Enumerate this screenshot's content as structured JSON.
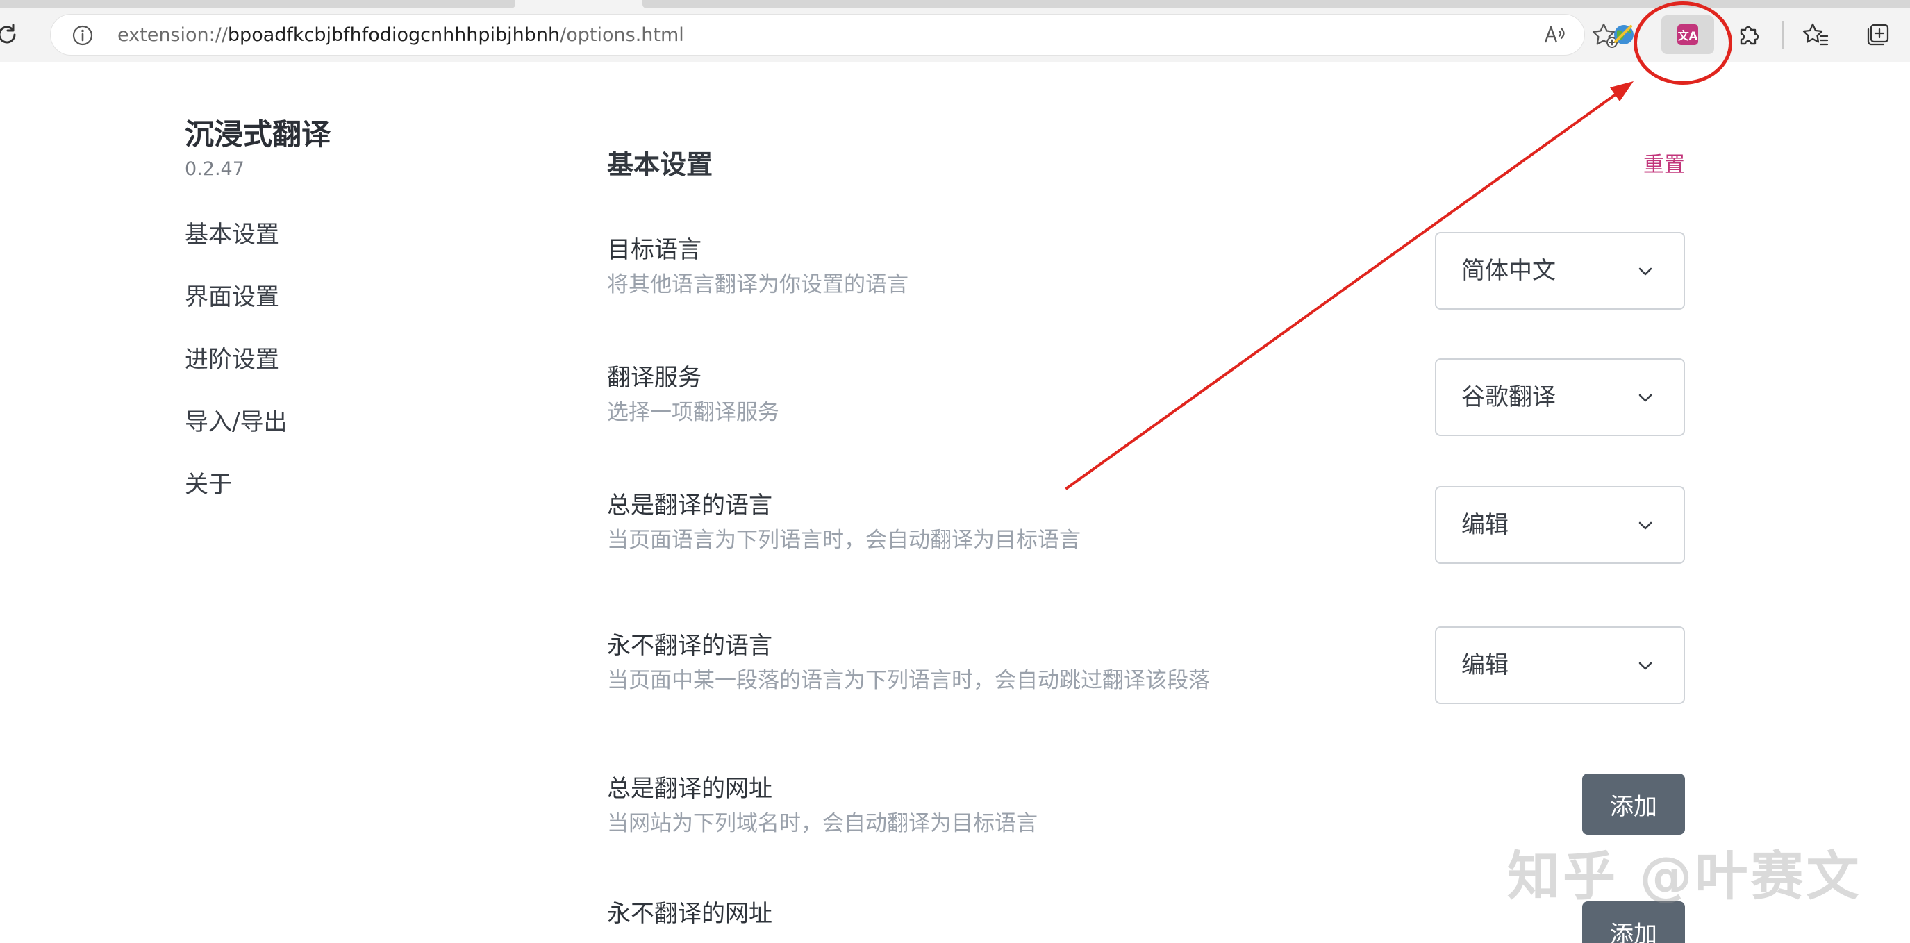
{
  "browser": {
    "url_scheme": "extension://",
    "url_host": "bpoadfkcbjbfhfodiogcnhhhpibjhbnh",
    "url_path": "/options.html"
  },
  "sidebar": {
    "title": "沉浸式翻译",
    "version": "0.2.47",
    "items": [
      {
        "label": "基本设置"
      },
      {
        "label": "界面设置"
      },
      {
        "label": "进阶设置"
      },
      {
        "label": "导入/导出"
      },
      {
        "label": "关于"
      }
    ]
  },
  "main": {
    "section_title": "基本设置",
    "reset_label": "重置",
    "settings": [
      {
        "label": "目标语言",
        "desc": "将其他语言翻译为你设置的语言",
        "control": "select",
        "value": "简体中文"
      },
      {
        "label": "翻译服务",
        "desc": "选择一项翻译服务",
        "control": "select",
        "value": "谷歌翻译"
      },
      {
        "label": "总是翻译的语言",
        "desc": "当页面语言为下列语言时，会自动翻译为目标语言",
        "control": "select",
        "value": "编辑"
      },
      {
        "label": "永不翻译的语言",
        "desc": "当页面中某一段落的语言为下列语言时，会自动跳过翻译该段落",
        "control": "select",
        "value": "编辑"
      },
      {
        "label": "总是翻译的网址",
        "desc": "当网站为下列域名时，会自动翻译为目标语言",
        "control": "button",
        "value": "添加"
      },
      {
        "label": "永不翻译的网址",
        "desc": "",
        "control": "button",
        "value": "添加"
      }
    ]
  },
  "watermark": "知乎 @叶赛文",
  "icons": {
    "reload": "reload-icon",
    "info": "info-icon",
    "read_aloud": "read-aloud-icon",
    "add_favorite": "add-favorite-icon",
    "earth_extension": "earth-extension-icon",
    "translate_extension": "translate-extension-icon",
    "extensions": "puzzle-icon",
    "favorites": "favorites-icon",
    "collections": "collections-icon",
    "chevron": "chevron-down-icon"
  },
  "colors": {
    "accent": "#c2357b",
    "annotation": "#e0251e",
    "button_bg": "#5b6672"
  }
}
